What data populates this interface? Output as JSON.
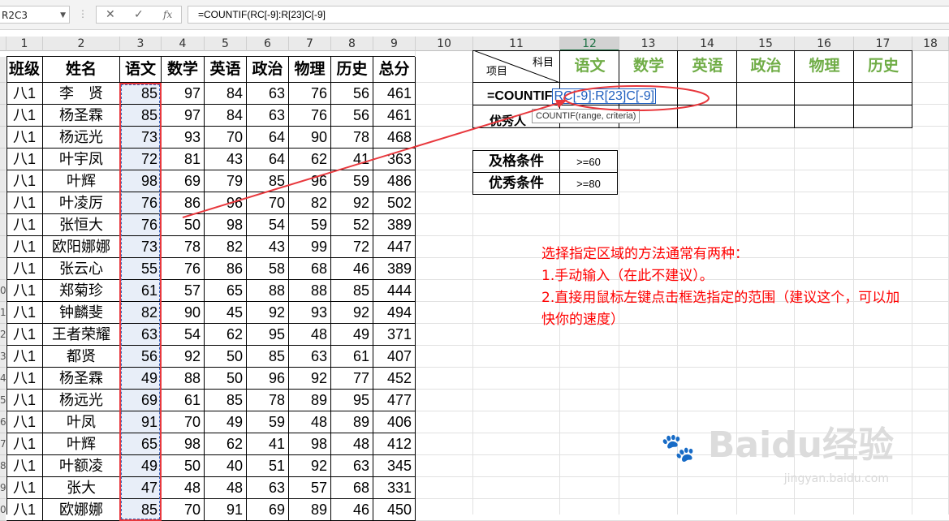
{
  "formula_bar": {
    "name_box": "R2C3",
    "cancel_icon": "✕",
    "enter_icon": "✓",
    "fx_label": "fx",
    "formula": "=COUNTIF(RC[-9]:R[23]C[-9]"
  },
  "columns": [
    "1",
    "2",
    "3",
    "4",
    "5",
    "6",
    "7",
    "8",
    "9",
    "10",
    "11",
    "12",
    "13",
    "14",
    "15",
    "16",
    "17",
    "18"
  ],
  "selected_column": "12",
  "table_headers": [
    "班级",
    "姓名",
    "语文",
    "数学",
    "英语",
    "政治",
    "物理",
    "历史",
    "总分"
  ],
  "rows": [
    [
      "八1",
      "李　贤",
      "85",
      "97",
      "84",
      "63",
      "76",
      "56",
      "461"
    ],
    [
      "八1",
      "杨圣霖",
      "85",
      "97",
      "84",
      "63",
      "76",
      "56",
      "461"
    ],
    [
      "八1",
      "杨远光",
      "73",
      "93",
      "70",
      "64",
      "90",
      "78",
      "468"
    ],
    [
      "八1",
      "叶宇凤",
      "72",
      "81",
      "43",
      "64",
      "62",
      "41",
      "363"
    ],
    [
      "八1",
      "叶辉",
      "98",
      "69",
      "79",
      "85",
      "96",
      "59",
      "486"
    ],
    [
      "八1",
      "叶凌厉",
      "76",
      "86",
      "96",
      "70",
      "82",
      "92",
      "502"
    ],
    [
      "八1",
      "张恒大",
      "76",
      "50",
      "98",
      "54",
      "59",
      "52",
      "389"
    ],
    [
      "八1",
      "欧阳娜娜",
      "73",
      "78",
      "82",
      "43",
      "99",
      "72",
      "447"
    ],
    [
      "八1",
      "张云心",
      "55",
      "76",
      "86",
      "58",
      "68",
      "46",
      "389"
    ],
    [
      "八1",
      "郑菊珍",
      "61",
      "57",
      "65",
      "88",
      "88",
      "85",
      "444"
    ],
    [
      "八1",
      "钟麟斐",
      "82",
      "90",
      "45",
      "92",
      "93",
      "92",
      "494"
    ],
    [
      "八1",
      "王者荣耀",
      "63",
      "54",
      "62",
      "95",
      "48",
      "49",
      "371"
    ],
    [
      "八1",
      "都贤",
      "56",
      "92",
      "50",
      "85",
      "63",
      "61",
      "407"
    ],
    [
      "八1",
      "杨圣霖",
      "49",
      "88",
      "50",
      "96",
      "92",
      "77",
      "452"
    ],
    [
      "八1",
      "杨远光",
      "69",
      "61",
      "85",
      "78",
      "89",
      "95",
      "477"
    ],
    [
      "八1",
      "叶凤",
      "91",
      "70",
      "49",
      "59",
      "48",
      "89",
      "406"
    ],
    [
      "八1",
      "叶辉",
      "65",
      "98",
      "62",
      "41",
      "98",
      "48",
      "412"
    ],
    [
      "八1",
      "叶额凌",
      "49",
      "50",
      "40",
      "51",
      "92",
      "63",
      "345"
    ],
    [
      "八1",
      "张大",
      "47",
      "48",
      "48",
      "63",
      "57",
      "68",
      "331"
    ],
    [
      "八1",
      "欧娜娜",
      "85",
      "70",
      "91",
      "69",
      "89",
      "46",
      "450"
    ]
  ],
  "row_numbers": [
    "",
    "",
    "",
    "",
    "",
    "",
    "",
    "",
    "",
    "0",
    "1",
    "2",
    "3",
    "4",
    "5",
    "6",
    "7",
    "8",
    "9",
    "0"
  ],
  "stats": {
    "diag_top": "科目",
    "diag_bottom": "项目",
    "subjects": [
      "语文",
      "数学",
      "英语",
      "政治",
      "物理",
      "历史"
    ],
    "row1_formula_prefix": "=COUNTIF",
    "row1_formula_ref": "RC[-9]:R[23]C[-9]",
    "row2_label": "优秀人",
    "tooltip": "COUNTIF(range, criteria)"
  },
  "conditions": [
    {
      "label": "及格条件",
      "value": ">=60"
    },
    {
      "label": "优秀条件",
      "value": ">=80"
    }
  ],
  "note_lines": [
    "选择指定区域的方法通常有两种：",
    "1.手动输入（在此不建议）。",
    "2.直接用鼠标左键点击框选指定的范围（建议这个，可以加",
    "快你的速度）"
  ],
  "watermark": "Baidu经验",
  "watermark_sub": "jingyan.baidu.com",
  "colors": {
    "accent_red": "#ff0000",
    "subject_green": "#70ad47",
    "ref_blue": "#1f5fbf",
    "selection_fill": "#e8eef8"
  }
}
